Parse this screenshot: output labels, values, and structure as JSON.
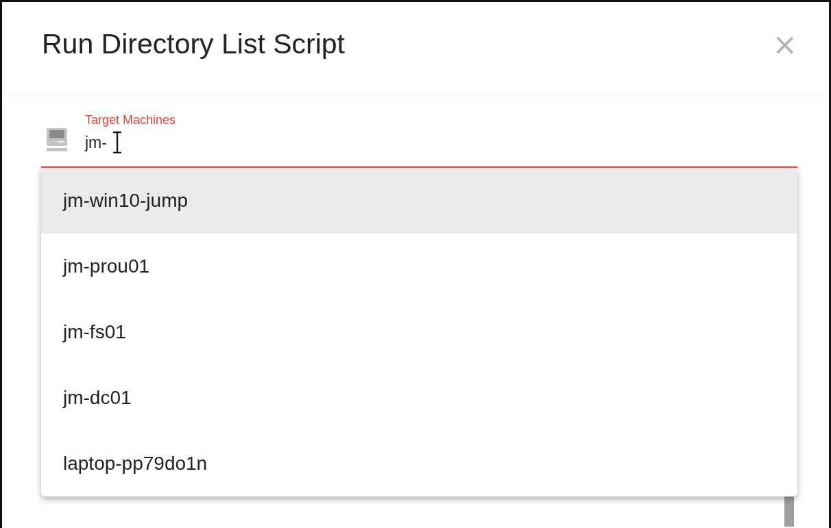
{
  "dialog": {
    "title": "Run Directory List Script",
    "close": "×"
  },
  "field": {
    "label": "Target Machines",
    "value": "jm-"
  },
  "suggestions": [
    {
      "label": "jm-win10-jump",
      "selected": true
    },
    {
      "label": "jm-prou01",
      "selected": false
    },
    {
      "label": "jm-fs01",
      "selected": false
    },
    {
      "label": "jm-dc01",
      "selected": false
    },
    {
      "label": "laptop-pp79do1n",
      "selected": false
    }
  ]
}
